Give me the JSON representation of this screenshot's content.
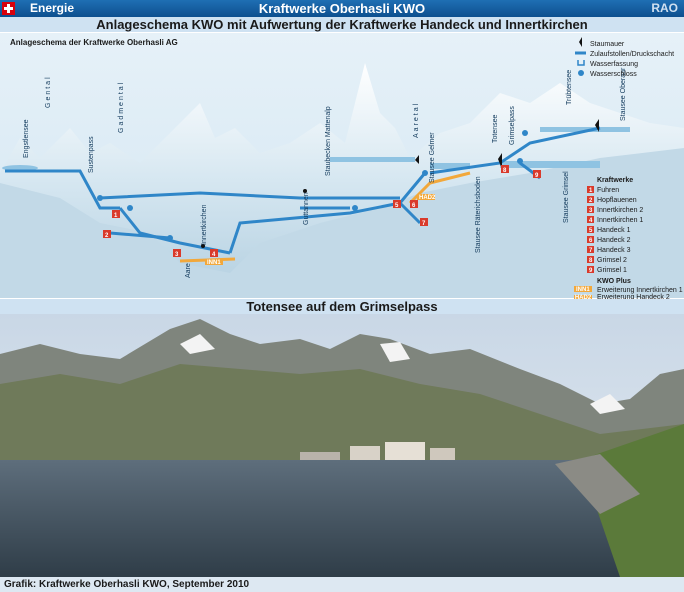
{
  "header": {
    "category": "Energie",
    "title": "Kraftwerke Oberhasli KWO",
    "logo": "RAO"
  },
  "diagram": {
    "heading": "Anlageschema KWO mit Aufwertung der Kraftwerke Handeck und Innertkirchen",
    "subheading": "Anlageschema der Kraftwerke Oberhasli AG",
    "legend_top": [
      "Staumauer",
      "Zulaufstollen/Druckschacht",
      "Wasserfassung",
      "Wasserschloss"
    ],
    "kraftwerke_title": "Kraftwerke",
    "kraftwerke": [
      {
        "num": "1",
        "name": "Fuhren"
      },
      {
        "num": "2",
        "name": "Hopflauenen"
      },
      {
        "num": "3",
        "name": "Innertkirchen 2"
      },
      {
        "num": "4",
        "name": "Innertkirchen 1"
      },
      {
        "num": "5",
        "name": "Handeck 1"
      },
      {
        "num": "6",
        "name": "Handeck 2"
      },
      {
        "num": "7",
        "name": "Handeck 3"
      },
      {
        "num": "8",
        "name": "Grimsel 2"
      },
      {
        "num": "9",
        "name": "Grimsel 1"
      }
    ],
    "plus_title": "KWO Plus",
    "plus": [
      {
        "badge": "INN1",
        "name": "Erweiterung Innertkirchen 1"
      },
      {
        "badge": "HAD2",
        "name": "Erweiterung Handeck 2"
      }
    ],
    "places": {
      "engstlensee": "Engstlensee",
      "gental": "Gental",
      "sustenpass": "Sustenpass",
      "gadmental": "Gadmental",
      "aare": "Aare",
      "innertkirchen": "Innertkirchen",
      "guttannen": "Guttannen",
      "staubecken": "Staubecken Mattenalp",
      "aaretal": "Aaretal",
      "gelmer": "Stausee Gelmer",
      "raeterichsboden": "Stausee Räterichsboden",
      "totensee": "Totensee",
      "grimselpass": "Grimselpass",
      "grimsel": "Stausee Grimsel",
      "truebtensee": "Trübtensee",
      "oberaar": "Stausee Oberaar"
    },
    "colors": {
      "pipe": "#2f86c8",
      "water": "#b9dcef",
      "mountain": "#cfe3ef",
      "plant": "#d93a2b",
      "plus": "#f2a83b"
    }
  },
  "photo": {
    "heading": "Totensee auf dem Grimselpass"
  },
  "footer": {
    "credit": "Grafik: Kraftwerke Oberhasli KWO, September 2010"
  }
}
